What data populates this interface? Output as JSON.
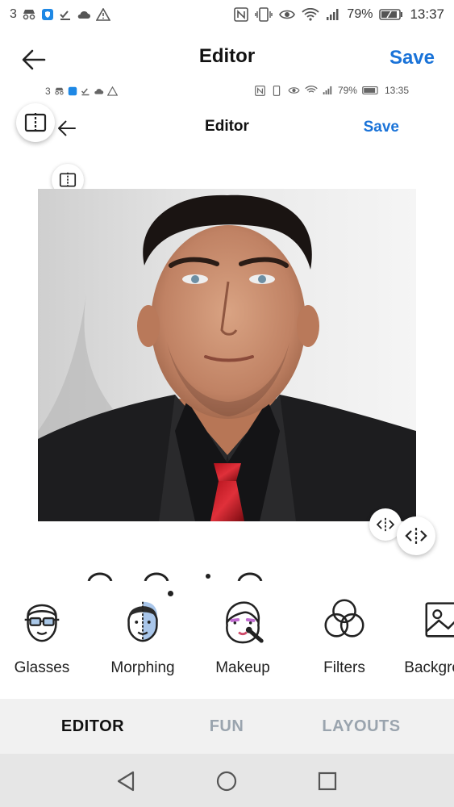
{
  "status_bar": {
    "carrier": "3",
    "battery_percent": "79%",
    "time": "13:37",
    "icons": [
      "incognito-icon",
      "shield-icon",
      "check-download-icon",
      "cloud-icon",
      "warning-icon",
      "nfc-icon",
      "vibrate-icon",
      "eye-icon",
      "wifi-icon",
      "signal-icon",
      "battery-icon"
    ]
  },
  "header": {
    "title": "Editor",
    "save_label": "Save"
  },
  "inner_screenshot": {
    "carrier": "3",
    "battery_percent": "79%",
    "time": "13:35",
    "title": "Editor",
    "save_label": "Save"
  },
  "photo": {
    "description_icon": "portrait-photo"
  },
  "tools": [
    {
      "label": "Glasses",
      "icon": "glasses-face-icon"
    },
    {
      "label": "Morphing",
      "icon": "morphing-face-icon"
    },
    {
      "label": "Makeup",
      "icon": "makeup-face-icon"
    },
    {
      "label": "Filters",
      "icon": "filters-rings-icon"
    },
    {
      "label": "Background",
      "icon": "background-image-icon"
    }
  ],
  "tabs": [
    {
      "label": "EDITOR",
      "active": true
    },
    {
      "label": "FUN",
      "active": false
    },
    {
      "label": "LAYOUTS",
      "active": false
    }
  ],
  "colors": {
    "accent": "#1a73d8",
    "tab_inactive": "#9aa4ae",
    "tab_bg": "#f1f1f1",
    "nav_bg": "#e6e6e6"
  }
}
